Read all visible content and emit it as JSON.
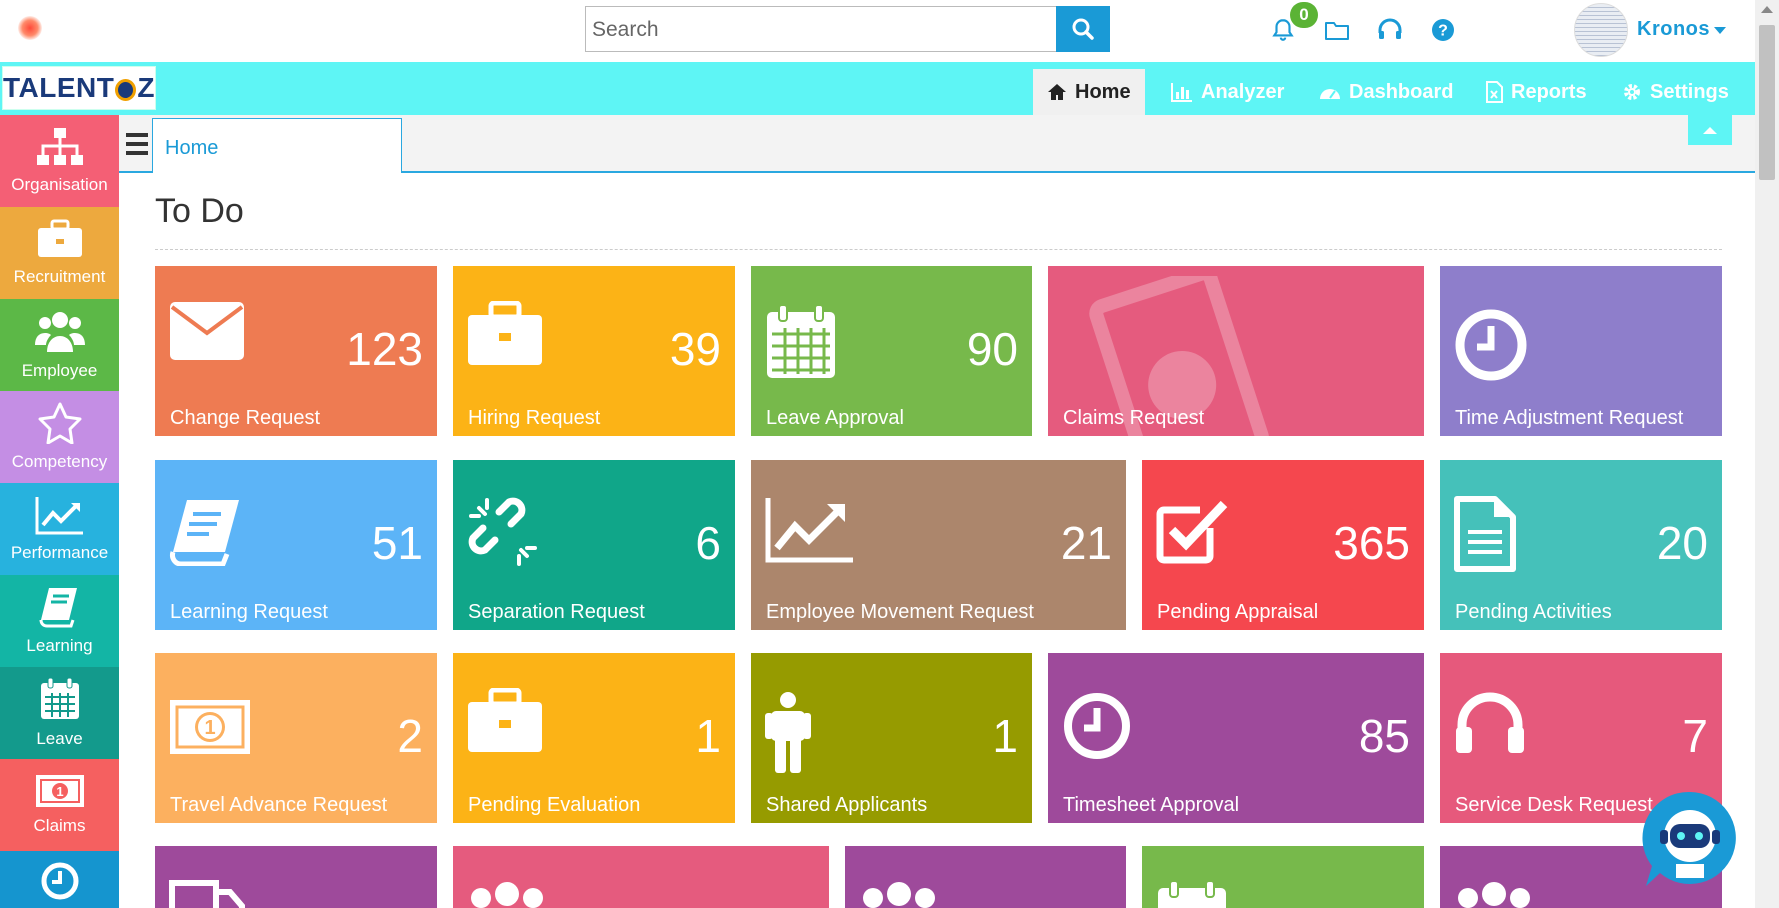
{
  "search": {
    "placeholder": "Search"
  },
  "notifications": {
    "count": "0"
  },
  "user": {
    "name": "Kronos"
  },
  "brand": {
    "name_left": "TALENT",
    "name_right": "Z"
  },
  "nav": {
    "home": "Home",
    "analyzer": "Analyzer",
    "dashboard": "Dashboard",
    "reports": "Reports",
    "settings": "Settings"
  },
  "sidebar": [
    {
      "label": "Organisation",
      "icon": "org-chart-icon",
      "color": "#f45f75"
    },
    {
      "label": "Recruitment",
      "icon": "briefcase-icon",
      "color": "#eda93e"
    },
    {
      "label": "Employee",
      "icon": "users-icon",
      "color": "#5cb847"
    },
    {
      "label": "Competency",
      "icon": "star-icon",
      "color": "#c48ee4"
    },
    {
      "label": "Performance",
      "icon": "chart-line-icon",
      "color": "#27b2de"
    },
    {
      "label": "Learning",
      "icon": "book-icon",
      "color": "#13b5a5"
    },
    {
      "label": "Leave",
      "icon": "calendar-icon",
      "color": "#139a8c"
    },
    {
      "label": "Claims",
      "icon": "money-icon",
      "color": "#f56060"
    },
    {
      "label": "",
      "icon": "clock-icon",
      "color": "#1595cf"
    }
  ],
  "tabs": {
    "home": "Home"
  },
  "page": {
    "title": "To Do"
  },
  "tiles": [
    {
      "label": "Change Request",
      "count": "123",
      "icon": "envelope-icon",
      "color": "#ee7b52"
    },
    {
      "label": "Hiring Request",
      "count": "39",
      "icon": "briefcase-icon",
      "color": "#fcb316"
    },
    {
      "label": "Leave Approval",
      "count": "90",
      "icon": "calendar-icon",
      "color": "#77b94b"
    },
    {
      "label": "Claims Request",
      "count": "",
      "icon": "money-icon",
      "color": "#e55b7e"
    },
    {
      "label": "Time Adjustment Request",
      "count": "",
      "icon": "clock-icon",
      "color": "#8e7ecb"
    },
    {
      "label": "Learning Request",
      "count": "51",
      "icon": "book-icon",
      "color": "#5cb4f7"
    },
    {
      "label": "Separation Request",
      "count": "6",
      "icon": "broken-link-icon",
      "color": "#10a689"
    },
    {
      "label": "Employee Movement Request",
      "count": "21",
      "icon": "chart-line-icon",
      "color": "#ac866c"
    },
    {
      "label": "Pending Appraisal",
      "count": "365",
      "icon": "check-square-icon",
      "color": "#f5474e"
    },
    {
      "label": "Pending Activities",
      "count": "20",
      "icon": "document-icon",
      "color": "#45c1ba"
    },
    {
      "label": "Travel Advance Request",
      "count": "2",
      "icon": "money-icon",
      "color": "#fcb05f"
    },
    {
      "label": "Pending Evaluation",
      "count": "1",
      "icon": "briefcase-icon",
      "color": "#fcb316"
    },
    {
      "label": "Shared Applicants",
      "count": "1",
      "icon": "person-icon",
      "color": "#969b00"
    },
    {
      "label": "Timesheet Approval",
      "count": "85",
      "icon": "clock-icon",
      "color": "#9e4a9b"
    },
    {
      "label": "Service Desk Request",
      "count": "7",
      "icon": "headset-icon",
      "color": "#e6597c"
    },
    {
      "label": "",
      "count": "",
      "icon": "truck-icon",
      "color": "#9e4a9b"
    },
    {
      "label": "",
      "count": "",
      "icon": "users-icon",
      "color": "#e55b7e"
    },
    {
      "label": "",
      "count": "",
      "icon": "users-icon",
      "color": "#9e4a9b"
    },
    {
      "label": "",
      "count": "",
      "icon": "calendar-icon",
      "color": "#77b94b"
    },
    {
      "label": "",
      "count": "",
      "icon": "users-icon",
      "color": "#9e4a9b"
    }
  ]
}
